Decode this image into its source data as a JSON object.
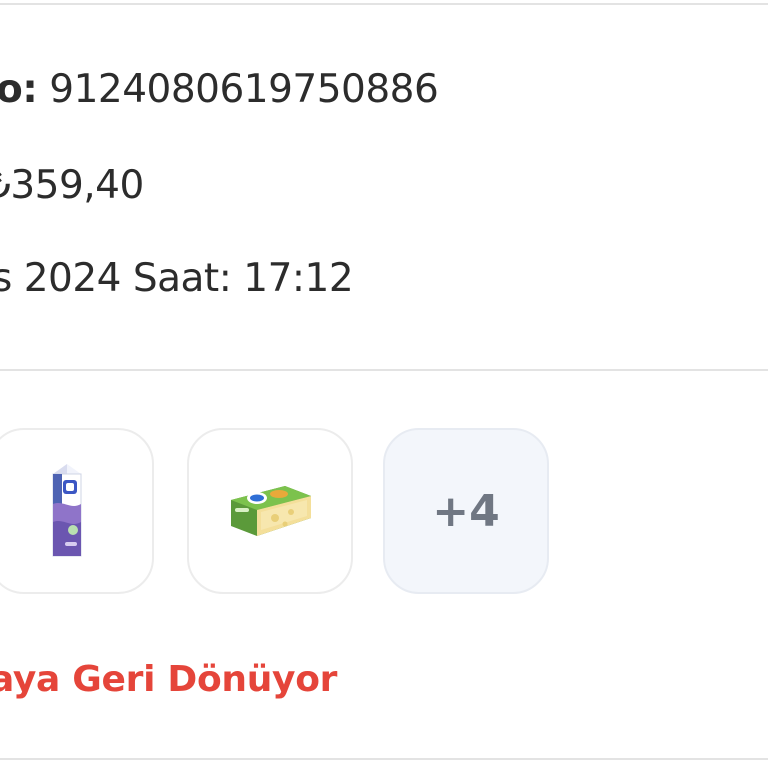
{
  "order": {
    "number_label": "o:",
    "number_value": "9124080619750886",
    "total_value": "₺359,40",
    "date_value": "s 2024",
    "time_label": "Saat:",
    "time_value": "17:12"
  },
  "products": {
    "items": [
      {
        "icon": "milk-carton-product-icon"
      },
      {
        "icon": "cheese-slices-product-icon"
      }
    ],
    "more_count": "+4"
  },
  "status": {
    "text": "aya Geri Dönüyor",
    "color": "#e5453a"
  }
}
